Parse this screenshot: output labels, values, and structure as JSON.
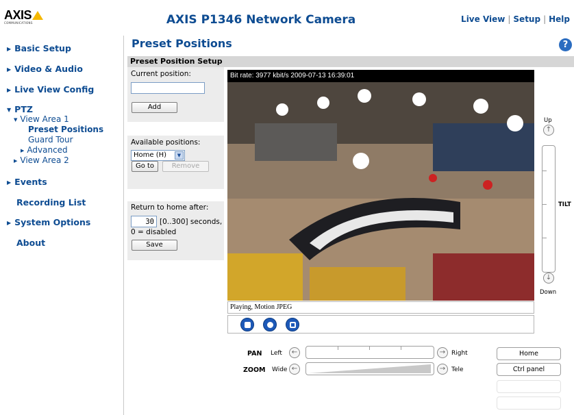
{
  "header": {
    "logo_text": "AXIS",
    "logo_sub": "COMMUNICATIONS",
    "title": "AXIS P1346 Network Camera",
    "nav": [
      "Live View",
      "Setup",
      "Help"
    ]
  },
  "sidebar": {
    "items": [
      {
        "label": "Basic Setup"
      },
      {
        "label": "Video & Audio"
      },
      {
        "label": "Live View Config"
      },
      {
        "label": "PTZ"
      },
      {
        "label": "Events"
      },
      {
        "label": "Recording List"
      },
      {
        "label": "System Options"
      },
      {
        "label": "About"
      }
    ],
    "ptz_children": {
      "view_area_1": "View Area 1",
      "preset_positions": "Preset Positions",
      "guard_tour": "Guard Tour",
      "advanced": "Advanced",
      "view_area_2": "View Area 2"
    }
  },
  "main": {
    "page_title": "Preset Positions",
    "section_title": "Preset Position Setup",
    "current_position_label": "Current position:",
    "current_position_value": "",
    "add_label": "Add",
    "available_positions_label": "Available positions:",
    "available_positions_selected": "Home (H)",
    "goto_label": "Go to",
    "remove_label": "Remove",
    "return_home_label": "Return to home after:",
    "return_home_value": "30",
    "return_home_range": "[0..300] seconds,",
    "return_home_note": "0 = disabled",
    "save_label": "Save"
  },
  "video": {
    "overlay_text": "Bit rate:  3977 kbit/s 2009-07-13 16:39:01",
    "status_text": "Playing, Motion JPEG"
  },
  "ptz_controls": {
    "tilt_up": "Up",
    "tilt_label": "TILT",
    "tilt_down": "Down",
    "pan_label": "PAN",
    "pan_left": "Left",
    "pan_right": "Right",
    "zoom_label": "ZOOM",
    "zoom_wide": "Wide",
    "zoom_tele": "Tele",
    "home_label": "Home",
    "ctrl_panel_label": "Ctrl panel"
  },
  "colors": {
    "link_blue": "#0e4c92",
    "section_bar": "#d6d6d6",
    "panel_bg": "#ececec",
    "logo_yellow": "#f5b800"
  }
}
